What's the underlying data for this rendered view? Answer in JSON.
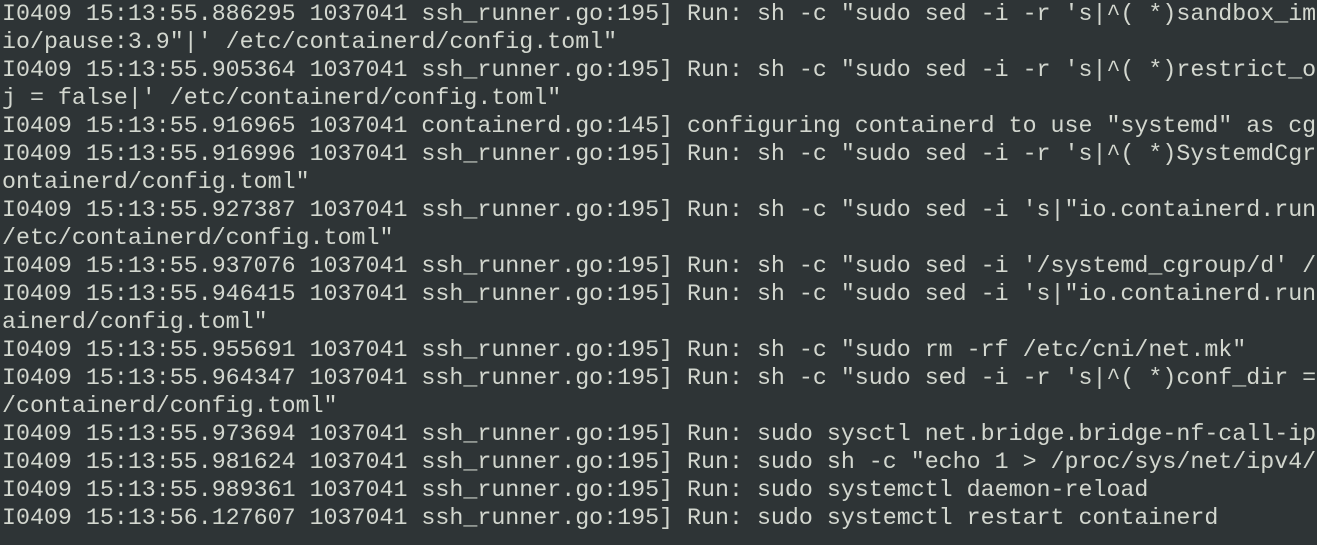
{
  "terminal": {
    "background": "#2e3436",
    "foreground": "#d3d7cf",
    "lines": [
      "I0409 15:13:55.886295 1037041 ssh_runner.go:195] Run: sh -c \"sudo sed -i -r 's|^( *)sandbox_im",
      "io/pause:3.9\"|' /etc/containerd/config.toml\"",
      "I0409 15:13:55.905364 1037041 ssh_runner.go:195] Run: sh -c \"sudo sed -i -r 's|^( *)restrict_o",
      "j = false|' /etc/containerd/config.toml\"",
      "I0409 15:13:55.916965 1037041 containerd.go:145] configuring containerd to use \"systemd\" as cg",
      "I0409 15:13:55.916996 1037041 ssh_runner.go:195] Run: sh -c \"sudo sed -i -r 's|^( *)SystemdCgr",
      "ontainerd/config.toml\"",
      "I0409 15:13:55.927387 1037041 ssh_runner.go:195] Run: sh -c \"sudo sed -i 's|\"io.containerd.run",
      "/etc/containerd/config.toml\"",
      "I0409 15:13:55.937076 1037041 ssh_runner.go:195] Run: sh -c \"sudo sed -i '/systemd_cgroup/d' /",
      "I0409 15:13:55.946415 1037041 ssh_runner.go:195] Run: sh -c \"sudo sed -i 's|\"io.containerd.run",
      "ainerd/config.toml\"",
      "I0409 15:13:55.955691 1037041 ssh_runner.go:195] Run: sh -c \"sudo rm -rf /etc/cni/net.mk\"",
      "I0409 15:13:55.964347 1037041 ssh_runner.go:195] Run: sh -c \"sudo sed -i -r 's|^( *)conf_dir =",
      "/containerd/config.toml\"",
      "I0409 15:13:55.973694 1037041 ssh_runner.go:195] Run: sudo sysctl net.bridge.bridge-nf-call-ip",
      "I0409 15:13:55.981624 1037041 ssh_runner.go:195] Run: sudo sh -c \"echo 1 > /proc/sys/net/ipv4/",
      "I0409 15:13:55.989361 1037041 ssh_runner.go:195] Run: sudo systemctl daemon-reload",
      "I0409 15:13:56.127607 1037041 ssh_runner.go:195] Run: sudo systemctl restart containerd"
    ]
  }
}
